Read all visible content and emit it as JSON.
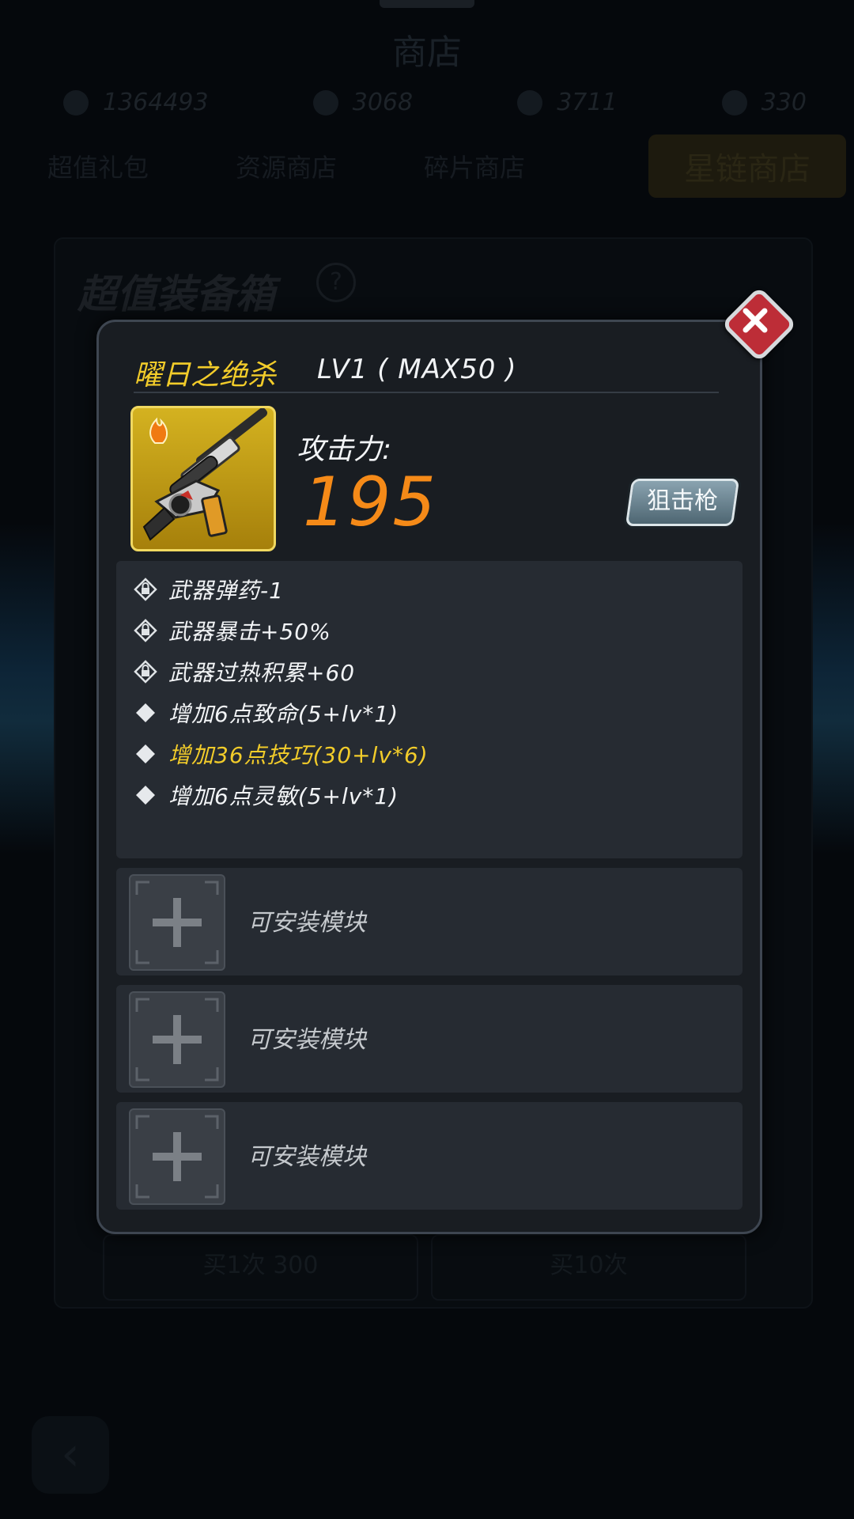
{
  "background": {
    "title": "商店",
    "currencies": [
      "1364493",
      "3068",
      "3711",
      "330"
    ],
    "tabs": [
      "超值礼包",
      "资源商店",
      "碎片商店"
    ],
    "active_tab": "星链商店",
    "card_title": "超值装备箱",
    "buy_one": "买1次",
    "buy_one_price": "300",
    "buy_ten": "买10次"
  },
  "modal": {
    "weapon_name": "曜日之绝杀",
    "level_text": "LV1 ( MAX50 )",
    "attack_label": "攻击力:",
    "attack_value": "195",
    "weapon_type": "狙击枪",
    "attributes": [
      {
        "text": "武器弹药-1",
        "icon": "lock-diamond-icon",
        "color": "#f2f4f6"
      },
      {
        "text": "武器暴击+50%",
        "icon": "lock-diamond-icon",
        "color": "#f2f4f6"
      },
      {
        "text": "武器过热积累+60",
        "icon": "lock-diamond-icon",
        "color": "#f2f4f6"
      },
      {
        "text": "增加6点致命(5+lv*1)",
        "icon": "diamond-bullet-icon",
        "color": "#f2f4f6"
      },
      {
        "text": "增加36点技巧(30+lv*6)",
        "icon": "diamond-bullet-icon",
        "color": "#f2cc2a"
      },
      {
        "text": "增加6点灵敏(5+lv*1)",
        "icon": "diamond-bullet-icon",
        "color": "#f2f4f6"
      }
    ],
    "module_slots": [
      {
        "label": "可安装模块"
      },
      {
        "label": "可安装模块"
      },
      {
        "label": "可安装模块"
      }
    ]
  },
  "colors": {
    "accent_yellow": "#f2cc2a",
    "attack_orange": "#f58a18",
    "close_red": "#bd2d37"
  }
}
